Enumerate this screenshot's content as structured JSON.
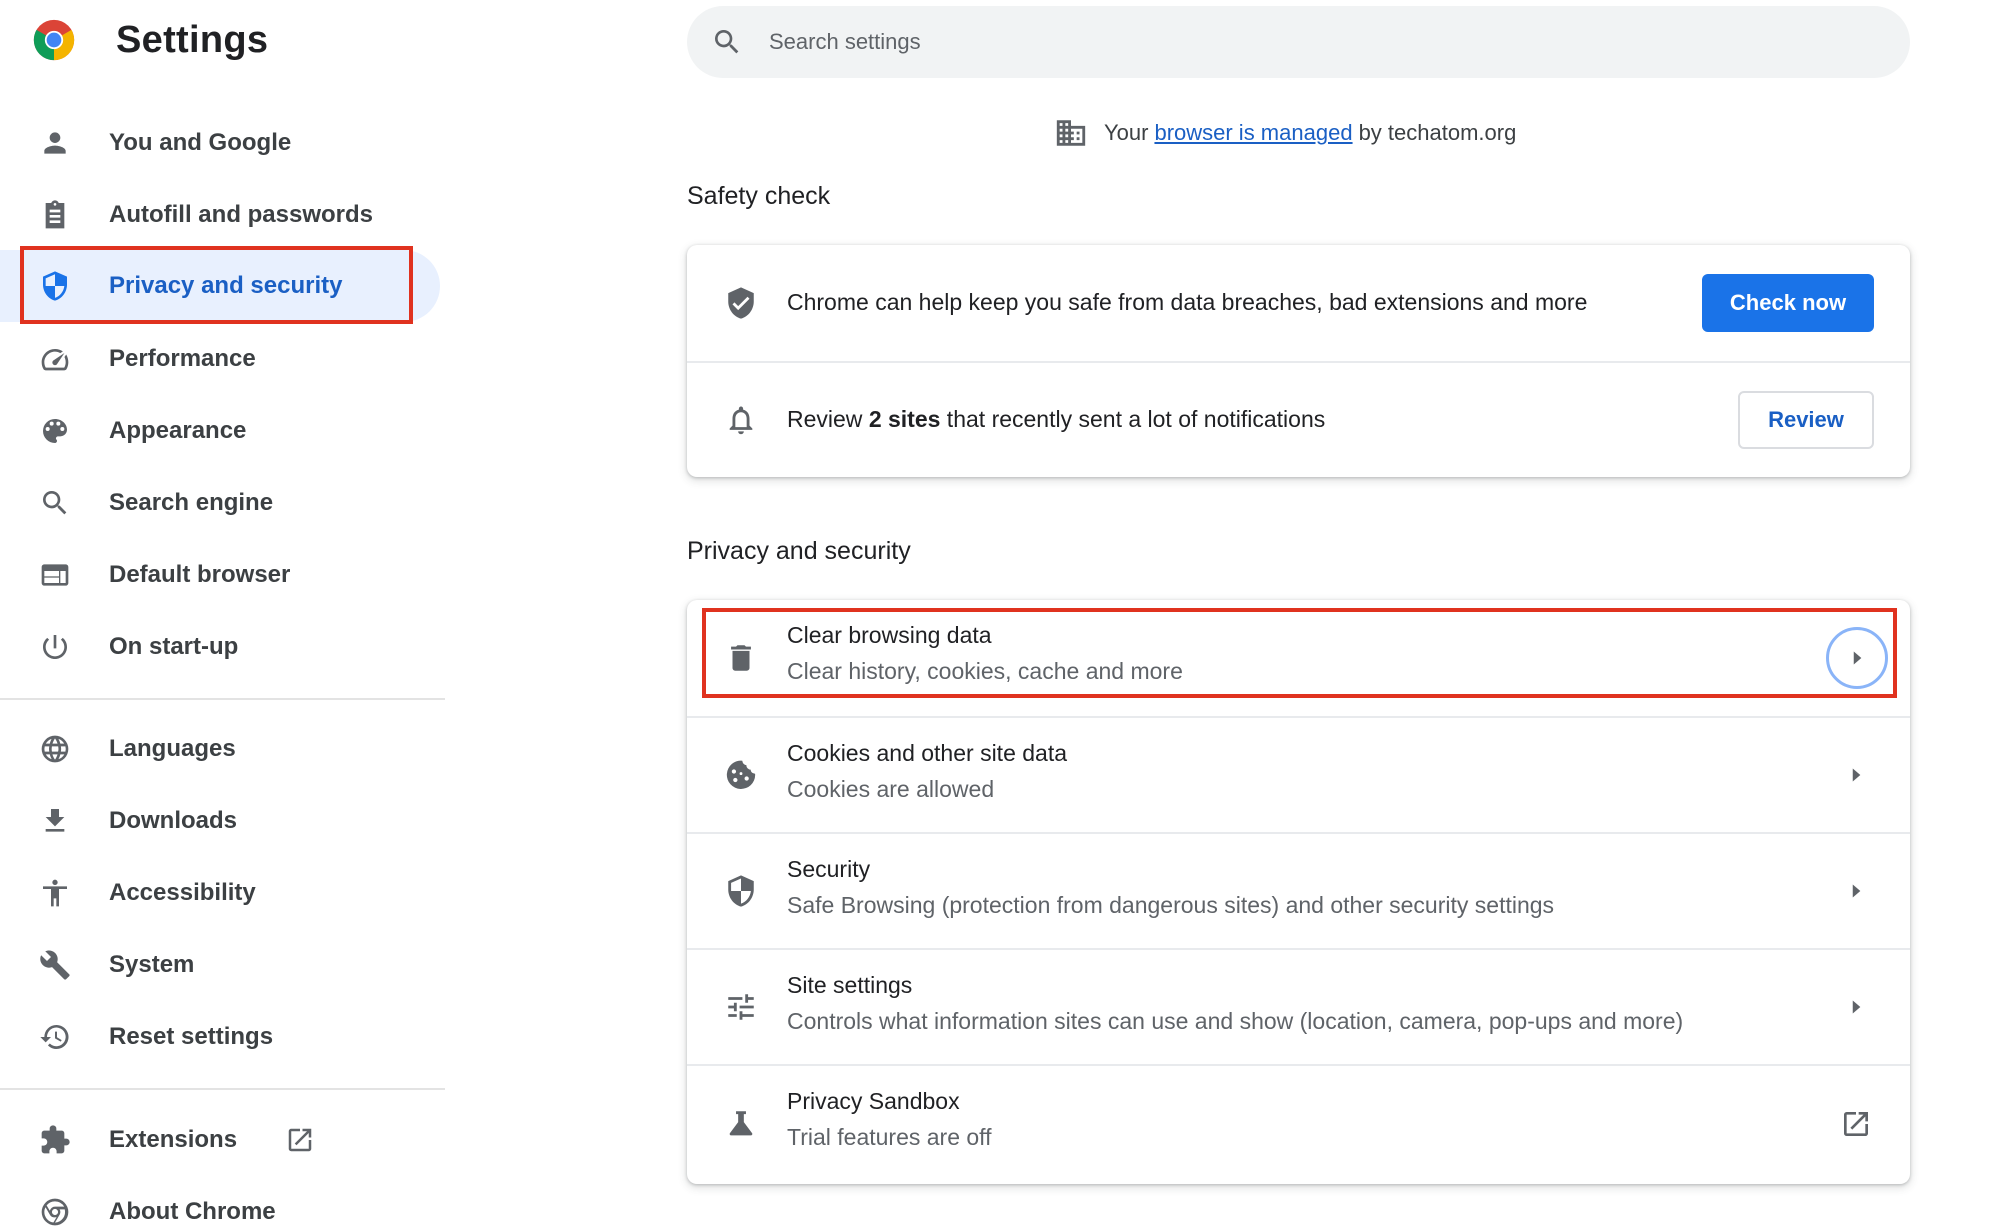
{
  "app": {
    "title": "Settings"
  },
  "search": {
    "placeholder": "Search settings"
  },
  "managed_notice": {
    "prefix": "Your",
    "link_text": "browser is managed",
    "suffix": "by techatom.org"
  },
  "sidebar": {
    "items": [
      {
        "label": "You and Google",
        "icon": "person-icon"
      },
      {
        "label": "Autofill and passwords",
        "icon": "clipboard-icon"
      },
      {
        "label": "Privacy and security",
        "icon": "shield-icon",
        "active": true
      },
      {
        "label": "Performance",
        "icon": "speedometer-icon"
      },
      {
        "label": "Appearance",
        "icon": "palette-icon"
      },
      {
        "label": "Search engine",
        "icon": "search-icon"
      },
      {
        "label": "Default browser",
        "icon": "browser-window-icon"
      },
      {
        "label": "On start-up",
        "icon": "power-icon"
      },
      {
        "label": "Languages",
        "icon": "globe-icon"
      },
      {
        "label": "Downloads",
        "icon": "download-icon"
      },
      {
        "label": "Accessibility",
        "icon": "accessibility-icon"
      },
      {
        "label": "System",
        "icon": "wrench-icon"
      },
      {
        "label": "Reset settings",
        "icon": "history-icon"
      },
      {
        "label": "Extensions",
        "icon": "puzzle-icon"
      },
      {
        "label": "About Chrome",
        "icon": "chrome-icon"
      }
    ]
  },
  "safety_check": {
    "title": "Safety check",
    "rows": [
      {
        "text": "Chrome can help keep you safe from data breaches, bad extensions and more",
        "button": "Check now",
        "icon": "shield-check-icon"
      },
      {
        "text_prefix": "Review ",
        "text_bold": "2 sites",
        "text_suffix": " that recently sent a lot of notifications",
        "button": "Review",
        "icon": "bell-icon"
      }
    ]
  },
  "privacy_section": {
    "title": "Privacy and security",
    "rows": [
      {
        "title": "Clear browsing data",
        "subtitle": "Clear history, cookies, cache and more",
        "icon": "trash-icon"
      },
      {
        "title": "Cookies and other site data",
        "subtitle": "Cookies are allowed",
        "icon": "cookie-icon"
      },
      {
        "title": "Security",
        "subtitle": "Safe Browsing (protection from dangerous sites) and other security settings",
        "icon": "security-shield-icon"
      },
      {
        "title": "Site settings",
        "subtitle": "Controls what information sites can use and show (location, camera, pop-ups and more)",
        "icon": "tune-icon"
      },
      {
        "title": "Privacy Sandbox",
        "subtitle": "Trial features are off",
        "icon": "flask-icon"
      }
    ]
  },
  "colors": {
    "accent": "#1a73e8",
    "highlight_box": "#e0321f",
    "active_bg": "#e8f0fe"
  }
}
